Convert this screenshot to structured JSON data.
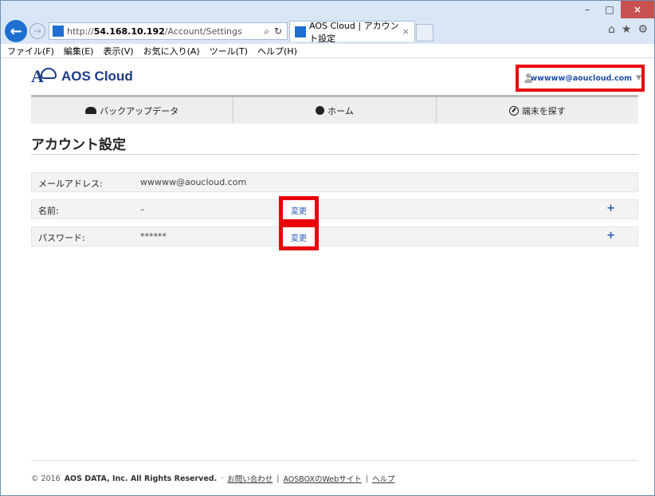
{
  "browser": {
    "url_prefix": "http://",
    "url_host": "54.168.10.192",
    "url_path": "/Account/Settings",
    "tab_title": "AOS Cloud | アカウント設定",
    "menu": [
      "ファイル(F)",
      "編集(E)",
      "表示(V)",
      "お気に入り(A)",
      "ツール(T)",
      "ヘルプ(H)"
    ]
  },
  "header": {
    "logo_text": "AOS Cloud",
    "user_email": "wwwww@aoucloud.com"
  },
  "nav": {
    "items": [
      {
        "label": "バックアップデータ",
        "icon": "cloud-icon"
      },
      {
        "label": "ホーム",
        "icon": "circle-icon"
      },
      {
        "label": "端末を探す",
        "icon": "compass-icon"
      }
    ]
  },
  "page": {
    "title": "アカウント設定"
  },
  "settings": [
    {
      "label": "メールアドレス:",
      "value": "wwwww@aoucloud.com"
    },
    {
      "label": "名前:",
      "value": "–",
      "change_label": "変更",
      "expand": "+"
    },
    {
      "label": "パスワード:",
      "value": "******",
      "change_label": "変更",
      "expand": "+"
    }
  ],
  "footer": {
    "copyright_prefix": "© 2016",
    "company": "AOS DATA, Inc. All Rights Reserved.",
    "sep1": "·",
    "contact": "お問い合わせ",
    "sep2": "|",
    "website": "AOSBOXのWebサイト",
    "sep3": "|",
    "help": "ヘルプ"
  },
  "colors": {
    "brand": "#1b3d84",
    "highlight": "#e8000b",
    "link": "#2a5bb6"
  }
}
